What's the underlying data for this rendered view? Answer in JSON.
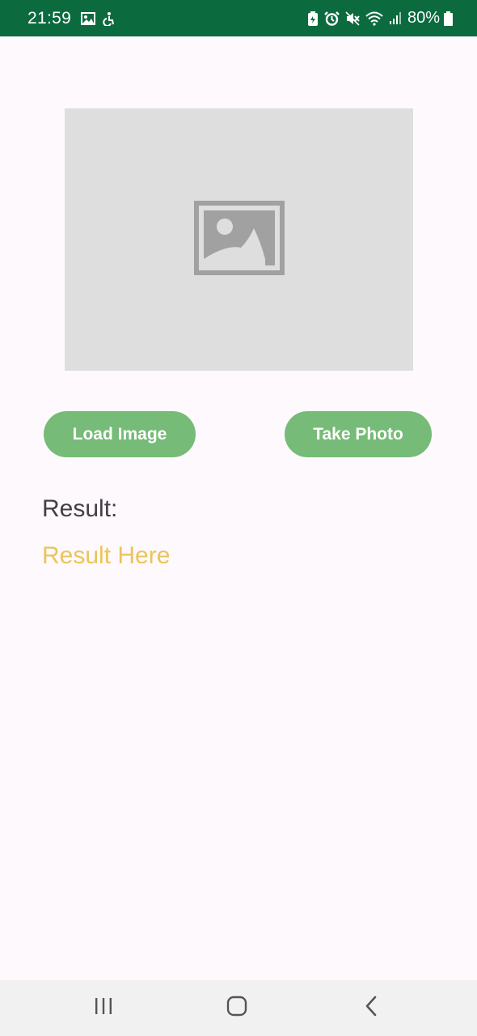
{
  "status_bar": {
    "time": "21:59",
    "battery_percent": "80%",
    "background_color": "#0b6b3f",
    "left_icons": [
      "gallery-notification-icon",
      "accessibility-notification-icon"
    ],
    "right_icons": [
      "battery-saver-icon",
      "alarm-icon",
      "mute-icon",
      "wifi-icon",
      "cellular-signal-icon",
      "battery-icon"
    ]
  },
  "image_view": {
    "icon": "image-placeholder-icon",
    "background_color": "#dedede"
  },
  "buttons": {
    "load_image": "Load Image",
    "take_photo": "Take Photo",
    "color": "#76bb77"
  },
  "result": {
    "label": "Result:",
    "value": "Result Here",
    "value_color": "#ecc458"
  },
  "nav_bar": {
    "icons": [
      "recent-apps-icon",
      "home-icon",
      "back-icon"
    ]
  }
}
